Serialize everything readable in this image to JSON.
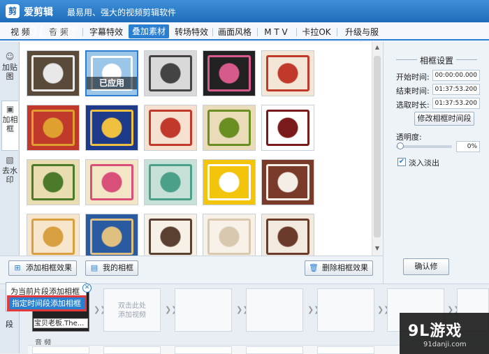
{
  "titlebar": {
    "logo": "剪",
    "app_name": "爱剪辑",
    "slogan": "最易用、强大的视频剪辑软件"
  },
  "tabs": [
    {
      "label": "视  频",
      "active": false
    },
    {
      "label": "音  频",
      "active": false
    },
    {
      "label": "字幕特效",
      "active": false
    },
    {
      "label": "叠加素材",
      "active": true
    },
    {
      "label": "转场特效",
      "active": false
    },
    {
      "label": "画面风格",
      "active": false
    },
    {
      "label": "M T V",
      "active": false
    },
    {
      "label": "卡拉OK",
      "active": false
    },
    {
      "label": "升级与服务",
      "active": false
    }
  ],
  "watermark_top": "9L游戏",
  "side_tabs": [
    {
      "label": "加贴图",
      "icon": "sticker-icon"
    },
    {
      "label": "加相框",
      "icon": "frame-icon",
      "active": true
    },
    {
      "label": "去水印",
      "icon": "remove-watermark-icon"
    }
  ],
  "frames": {
    "applied_label": "已应用",
    "items": [
      {
        "name": "dark-wood-frame",
        "color": "#5a4a3a",
        "accent": "#e8e8e8"
      },
      {
        "name": "blue-ornate-frame",
        "color": "#9cc6e8",
        "accent": "#ffffff",
        "selected": true,
        "applied": true
      },
      {
        "name": "ink-landscape-frame",
        "color": "#d9d9d9",
        "accent": "#444444"
      },
      {
        "name": "lotus-frame",
        "color": "#222222",
        "accent": "#d65a8c"
      },
      {
        "name": "pagoda-blossom-frame",
        "color": "#f4e6d6",
        "accent": "#c0392b"
      },
      {
        "name": "red-dragon-frame",
        "color": "#c0392b",
        "accent": "#e0a030"
      },
      {
        "name": "blue-pattern-frame",
        "color": "#1e3a8a",
        "accent": "#f0c040"
      },
      {
        "name": "red-knot-frame",
        "color": "#f6e1d0",
        "accent": "#c0392b"
      },
      {
        "name": "bird-flower-frame",
        "color": "#eadcb8",
        "accent": "#6b8e23"
      },
      {
        "name": "lattice-frame",
        "color": "#ffffff",
        "accent": "#7a1a1a"
      },
      {
        "name": "willow-frame",
        "color": "#e8dcb0",
        "accent": "#4a7a2a"
      },
      {
        "name": "peony-frame",
        "color": "#f3e6c6",
        "accent": "#d8507a"
      },
      {
        "name": "green-square-frame",
        "color": "#c7e0d8",
        "accent": "#4aa088"
      },
      {
        "name": "gold-frame",
        "color": "#f2c40c",
        "accent": "#ffffff"
      },
      {
        "name": "cloud-frame",
        "color": "#7a3a2a",
        "accent": "#f4eee6"
      },
      {
        "name": "gold-pattern-frame",
        "color": "#f7e6cc",
        "accent": "#d8a040"
      },
      {
        "name": "tile-frame",
        "color": "#2a5aa0",
        "accent": "#e0c080"
      },
      {
        "name": "eaves-frame",
        "color": "#f6f0e6",
        "accent": "#5a4030"
      },
      {
        "name": "beige-frame",
        "color": "#f7f1e8",
        "accent": "#d8c8b0"
      },
      {
        "name": "brown-eaves-frame",
        "color": "#f3eadf",
        "accent": "#6a3a2a"
      }
    ]
  },
  "right_panel": {
    "title": "相框设置",
    "start_label": "开始时间:",
    "start_value": "00:00:00.000",
    "end_label": "结束时间:",
    "end_value": "01:37:53.200",
    "duration_label": "选取时长:",
    "duration_value": "01:37:53.200",
    "modify_button": "修改相框时间段",
    "opacity_label": "透明度:",
    "opacity_value": "0%",
    "fade_checked": true,
    "fade_label": "淡入淡出",
    "confirm_button": "确认修"
  },
  "toolbar": {
    "add_effect": "添加相框效果",
    "my_frames": "我的相框",
    "delete_effect": "删除相框效果"
  },
  "popup": {
    "item1": "为当前片段添加相框",
    "item2": "指定时间段添加相框"
  },
  "timeline": {
    "segment_tab": "段",
    "placeholder": "双击此处\n添加视频",
    "clip_name": "宝贝老板.The...",
    "audio_label": "音  频"
  },
  "brand": {
    "logo": "9L游戏",
    "url": "91danji.com"
  }
}
